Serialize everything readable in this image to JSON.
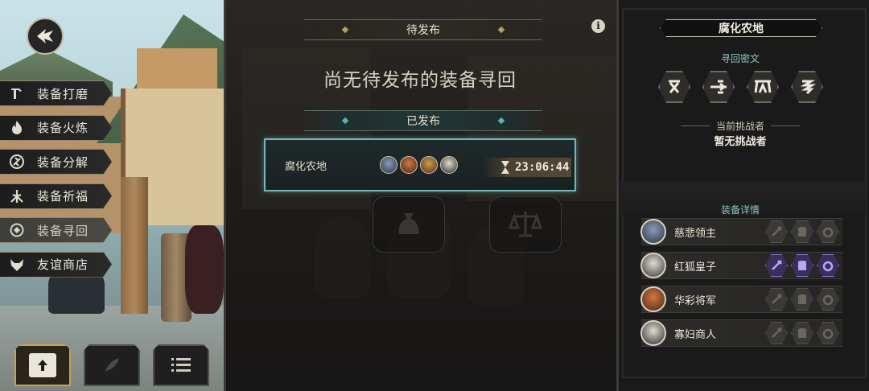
{
  "navigation": {
    "back_icon": "back-arrow-icon"
  },
  "menu": {
    "items": [
      {
        "label": "装备打磨",
        "icon": "hammer-icon",
        "active": false
      },
      {
        "label": "装备火炼",
        "icon": "flame-icon",
        "active": false
      },
      {
        "label": "装备分解",
        "icon": "decompose-icon",
        "active": false
      },
      {
        "label": "装备祈福",
        "icon": "blessing-icon",
        "active": false
      },
      {
        "label": "装备寻回",
        "icon": "retrieve-icon",
        "active": true
      },
      {
        "label": "友谊商店",
        "icon": "fox-icon",
        "active": false
      }
    ]
  },
  "bottom_buttons": [
    {
      "icon": "upload-icon",
      "active": true
    },
    {
      "icon": "feather-icon",
      "active": false
    },
    {
      "icon": "list-icon",
      "active": false
    }
  ],
  "pending": {
    "header": "待发布",
    "empty_message": "尚无待发布的装备寻回"
  },
  "published": {
    "header": "已发布",
    "entries": [
      {
        "name": "腐化农地",
        "timer": "23:06:44",
        "avatar_count": 4
      }
    ]
  },
  "info_button": {
    "label": "i"
  },
  "detail_panel": {
    "zone_title": "腐化农地",
    "cipher_label": "寻回密文",
    "runes": [
      "rune-x-icon",
      "rune-arrow-icon",
      "rune-gate-icon",
      "rune-coil-icon"
    ],
    "challenger_label": "当前挑战者",
    "challenger_value": "暂无挑战者",
    "equipment_label": "装备详情",
    "bosses": [
      {
        "name": "慈悲领主",
        "slots_active": false
      },
      {
        "name": "红狐皇子",
        "slots_active": true
      },
      {
        "name": "华彩将军",
        "slots_active": false
      },
      {
        "name": "寡妇商人",
        "slots_active": false
      }
    ]
  },
  "colors": {
    "accent_teal": "#6fb7b9",
    "accent_gold": "#c9a24a",
    "active_purple": "#8d76d9"
  }
}
